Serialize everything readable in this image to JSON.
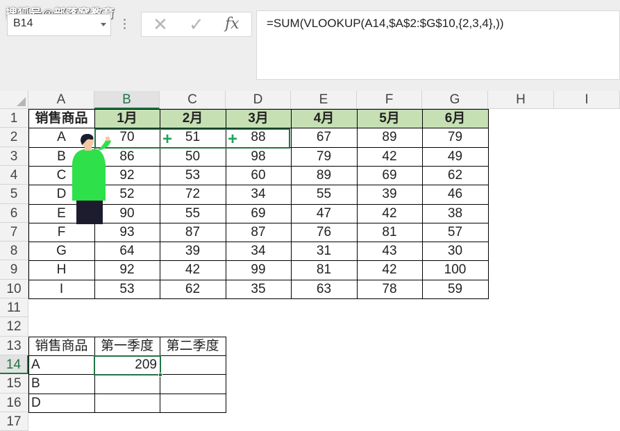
{
  "watermark": "搜狐号@部落窝教育",
  "namebox": {
    "value": "B14"
  },
  "formula_bar": {
    "cancel_icon": "x-icon",
    "enter_icon": "check-icon",
    "fx_label": "fx",
    "formula": "=SUM(VLOOKUP(A14,$A$2:$G$10,{2,3,4},))"
  },
  "columns": [
    "A",
    "B",
    "C",
    "D",
    "E",
    "F",
    "G",
    "H",
    "I"
  ],
  "rows": [
    "1",
    "2",
    "3",
    "4",
    "5",
    "6",
    "7",
    "8",
    "9",
    "10",
    "11",
    "12",
    "13",
    "14",
    "15",
    "16",
    "17"
  ],
  "table1": {
    "headers": [
      "销售商品",
      "1月",
      "2月",
      "3月",
      "4月",
      "5月",
      "6月"
    ],
    "rows": [
      [
        "A",
        "70",
        "51",
        "88",
        "67",
        "89",
        "79"
      ],
      [
        "B",
        "86",
        "50",
        "98",
        "79",
        "42",
        "49"
      ],
      [
        "C",
        "92",
        "53",
        "60",
        "89",
        "69",
        "62"
      ],
      [
        "D",
        "52",
        "72",
        "34",
        "55",
        "39",
        "46"
      ],
      [
        "E",
        "90",
        "55",
        "69",
        "47",
        "42",
        "38"
      ],
      [
        "F",
        "93",
        "87",
        "87",
        "76",
        "81",
        "57"
      ],
      [
        "G",
        "64",
        "39",
        "34",
        "31",
        "43",
        "30"
      ],
      [
        "H",
        "92",
        "42",
        "99",
        "81",
        "42",
        "100"
      ],
      [
        "I",
        "53",
        "62",
        "35",
        "63",
        "78",
        "59"
      ]
    ]
  },
  "table2": {
    "headers": [
      "销售商品",
      "第一季度",
      "第二季度"
    ],
    "rows": [
      [
        "A",
        "209",
        ""
      ],
      [
        "B",
        "",
        ""
      ],
      [
        "D",
        "",
        ""
      ]
    ]
  },
  "plus_markers": [
    "+",
    "+"
  ],
  "colors": {
    "accent": "#217346",
    "header_fill": "#c6e0b4",
    "plus": "#21a35a"
  }
}
